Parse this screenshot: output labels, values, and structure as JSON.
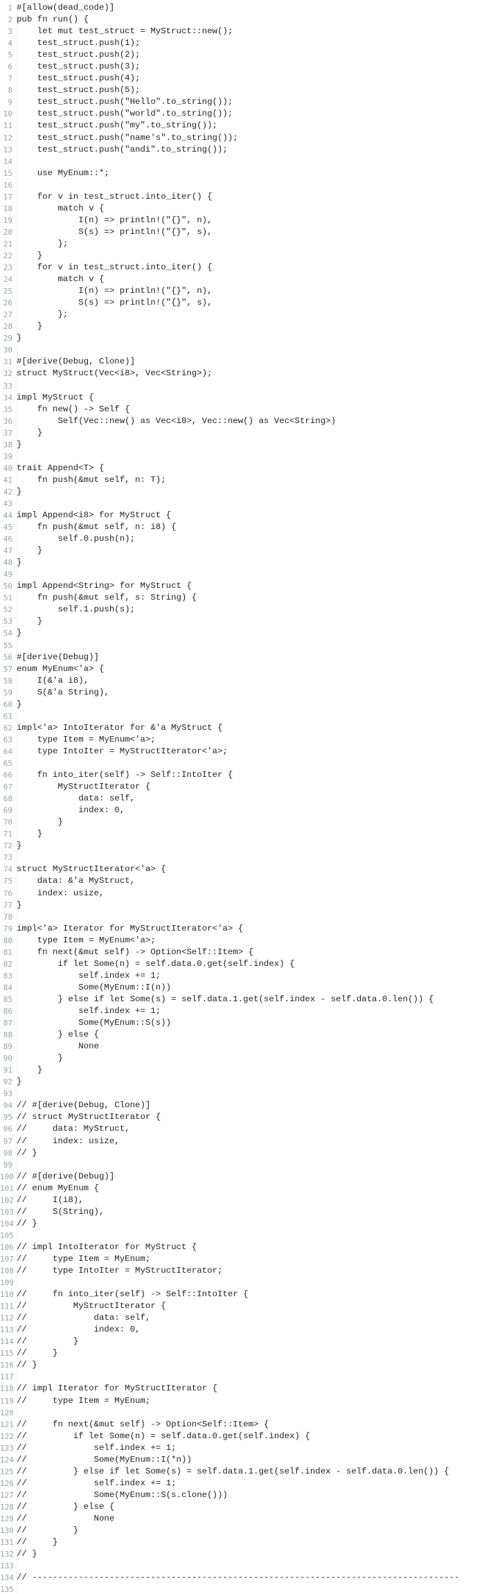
{
  "editor": {
    "lines": [
      "#[allow(dead_code)]",
      "pub fn run() {",
      "    let mut test_struct = MyStruct::new();",
      "    test_struct.push(1);",
      "    test_struct.push(2);",
      "    test_struct.push(3);",
      "    test_struct.push(4);",
      "    test_struct.push(5);",
      "    test_struct.push(\"Hello\".to_string());",
      "    test_struct.push(\"world\".to_string());",
      "    test_struct.push(\"my\".to_string());",
      "    test_struct.push(\"name's\".to_string());",
      "    test_struct.push(\"andi\".to_string());",
      "",
      "    use MyEnum::*;",
      "",
      "    for v in test_struct.into_iter() {",
      "        match v {",
      "            I(n) => println!(\"{}\", n),",
      "            S(s) => println!(\"{}\", s),",
      "        };",
      "    }",
      "    for v in test_struct.into_iter() {",
      "        match v {",
      "            I(n) => println!(\"{}\", n),",
      "            S(s) => println!(\"{}\", s),",
      "        };",
      "    }",
      "}",
      "",
      "#[derive(Debug, Clone)]",
      "struct MyStruct(Vec<i8>, Vec<String>);",
      "",
      "impl MyStruct {",
      "    fn new() -> Self {",
      "        Self(Vec::new() as Vec<i8>, Vec::new() as Vec<String>)",
      "    }",
      "}",
      "",
      "trait Append<T> {",
      "    fn push(&mut self, n: T);",
      "}",
      "",
      "impl Append<i8> for MyStruct {",
      "    fn push(&mut self, n: i8) {",
      "        self.0.push(n);",
      "    }",
      "}",
      "",
      "impl Append<String> for MyStruct {",
      "    fn push(&mut self, s: String) {",
      "        self.1.push(s);",
      "    }",
      "}",
      "",
      "#[derive(Debug)]",
      "enum MyEnum<'a> {",
      "    I(&'a i8),",
      "    S(&'a String),",
      "}",
      "",
      "impl<'a> IntoIterator for &'a MyStruct {",
      "    type Item = MyEnum<'a>;",
      "    type IntoIter = MyStructIterator<'a>;",
      "",
      "    fn into_iter(self) -> Self::IntoIter {",
      "        MyStructIterator {",
      "            data: self,",
      "            index: 0,",
      "        }",
      "    }",
      "}",
      "",
      "struct MyStructIterator<'a> {",
      "    data: &'a MyStruct,",
      "    index: usize,",
      "}",
      "",
      "impl<'a> Iterator for MyStructIterator<'a> {",
      "    type Item = MyEnum<'a>;",
      "    fn next(&mut self) -> Option<Self::Item> {",
      "        if let Some(n) = self.data.0.get(self.index) {",
      "            self.index += 1;",
      "            Some(MyEnum::I(n))",
      "        } else if let Some(s) = self.data.1.get(self.index - self.data.0.len()) {",
      "            self.index += 1;",
      "            Some(MyEnum::S(s))",
      "        } else {",
      "            None",
      "        }",
      "    }",
      "}",
      "",
      "// #[derive(Debug, Clone)]",
      "// struct MyStructIterator {",
      "//     data: MyStruct,",
      "//     index: usize,",
      "// }",
      "",
      "// #[derive(Debug)]",
      "// enum MyEnum {",
      "//     I(i8),",
      "//     S(String),",
      "// }",
      "",
      "// impl IntoIterator for MyStruct {",
      "//     type Item = MyEnum;",
      "//     type IntoIter = MyStructIterator;",
      "",
      "//     fn into_iter(self) -> Self::IntoIter {",
      "//         MyStructIterator {",
      "//             data: self,",
      "//             index: 0,",
      "//         }",
      "//     }",
      "// }",
      "",
      "// impl Iterator for MyStructIterator {",
      "//     type Item = MyEnum;",
      "",
      "//     fn next(&mut self) -> Option<Self::Item> {",
      "//         if let Some(n) = self.data.0.get(self.index) {",
      "//             self.index += 1;",
      "//             Some(MyEnum::I(*n))",
      "//         } else if let Some(s) = self.data.1.get(self.index - self.data.0.len()) {",
      "//             self.index += 1;",
      "//             Some(MyEnum::S(s.clone()))",
      "//         } else {",
      "//             None",
      "//         }",
      "//     }",
      "// }",
      "",
      "// -----------------------------------------------------------------------------------",
      ""
    ]
  }
}
